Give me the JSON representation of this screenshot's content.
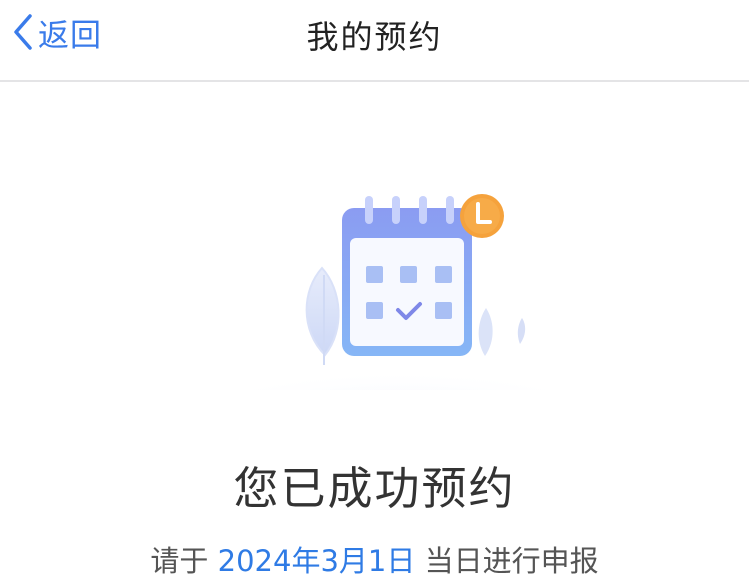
{
  "nav": {
    "back_label": "返回",
    "title": "我的预约"
  },
  "main": {
    "illustration_icon": "calendar-with-clock-icon",
    "success_title": "您已成功预约",
    "instruction_prefix": "请于 ",
    "instruction_date": "2024年3月1日",
    "instruction_suffix": " 当日进行申报"
  },
  "colors": {
    "accent": "#2f7be5",
    "clock_badge": "#f5a23c",
    "calendar": "#8fa7f0"
  }
}
